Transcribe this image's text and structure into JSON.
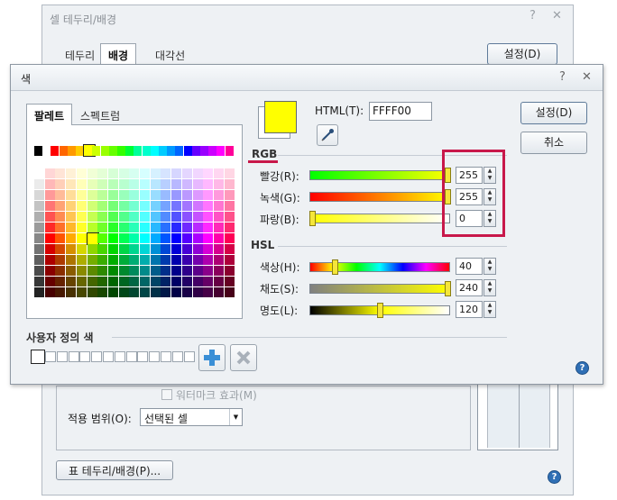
{
  "bg_dialog": {
    "title": "셀 테두리/배경",
    "help_glyph": "?",
    "close_glyph": "✕",
    "tabs": [
      "테두리",
      "배경",
      "대각선"
    ],
    "active_tab": "배경",
    "set_button": "설정(D)",
    "watermark_checkbox": "워터마크 효과(M)",
    "scope_label": "적용 범위(O):",
    "scope_value": "선택된 셀",
    "table_border_button": "표 테두리/배경(P)..."
  },
  "color_dialog": {
    "title": "색",
    "help_glyph": "?",
    "close_glyph": "✕",
    "tabs": [
      "팔레트",
      "스펙트럼"
    ],
    "active_tab": "팔레트",
    "html_label": "HTML(T):",
    "html_value": "FFFF00",
    "current_color": "#ffff00",
    "rgb_label": "RGB",
    "hsl_label": "HSL",
    "custom_colors_label": "사용자 정의 색",
    "custom_color_slots": 14,
    "buttons": {
      "ok": "설정(D)",
      "cancel": "취소"
    },
    "rgb": [
      {
        "label": "빨강(R):",
        "value": "255",
        "fraction": 1.0
      },
      {
        "label": "녹색(G):",
        "value": "255",
        "fraction": 1.0
      },
      {
        "label": "파랑(B):",
        "value": "0",
        "fraction": 0.0
      }
    ],
    "hsl": [
      {
        "label": "색상(H):",
        "value": "40",
        "fraction": 0.167
      },
      {
        "label": "채도(S):",
        "value": "240",
        "fraction": 1.0
      },
      {
        "label": "명도(L):",
        "value": "120",
        "fraction": 0.5
      }
    ],
    "highlight_color": "#c8184a"
  }
}
